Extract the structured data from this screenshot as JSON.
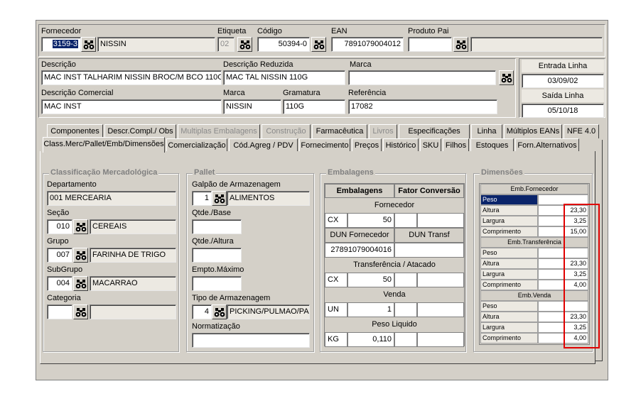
{
  "header": {
    "fornecedor_label": "Fornecedor",
    "fornecedor_code": "3159-3",
    "fornecedor_name": "NISSIN",
    "etiqueta_label": "Etiqueta",
    "etiqueta_value": "02",
    "codigo_label": "Código",
    "codigo_value": "50394-0",
    "ean_label": "EAN",
    "ean_value": "7891079004012",
    "produto_pai_label": "Produto Pai",
    "produto_pai_value": "",
    "descricao_label": "Descrição",
    "descricao_value": "MAC INST TALHARIM NISSIN BROC/M BCO 110G",
    "descricao_reduzida_label": "Descrição Reduzida",
    "descricao_reduzida_value": "MAC TAL NISSIN 110G",
    "marca_label": "Marca",
    "marca_top_value": "",
    "descricao_comercial_label": "Descrição Comercial",
    "descricao_comercial_value": "MAC INST",
    "marca2_label": "Marca",
    "marca2_value": "NISSIN",
    "gramatura_label": "Gramatura",
    "gramatura_value": "110G",
    "referencia_label": "Referência",
    "referencia_value": "17082",
    "entrada_linha_label": "Entrada Linha",
    "entrada_linha_value": "03/09/02",
    "saida_linha_label": "Saída Linha",
    "saida_linha_value": "05/10/18"
  },
  "tabs_row1": [
    {
      "label": "Componentes",
      "enabled": true
    },
    {
      "label": "Descr.Compl./ Obs",
      "enabled": true
    },
    {
      "label": "Multiplas Embalagens",
      "enabled": false
    },
    {
      "label": "Construção",
      "enabled": false
    },
    {
      "label": "Farmacêutica",
      "enabled": true
    },
    {
      "label": "Livros",
      "enabled": false
    },
    {
      "label": "Especificações",
      "enabled": true
    },
    {
      "label": "Linha",
      "enabled": true
    },
    {
      "label": "Múltiplos EANs",
      "enabled": true
    },
    {
      "label": "NFE 4.0",
      "enabled": true
    }
  ],
  "tabs_row2": [
    {
      "label": "Class.Merc/Pallet/Emb/Dimensões",
      "active": true
    },
    {
      "label": "Comercialização"
    },
    {
      "label": "Cód.Agreg / PDV"
    },
    {
      "label": "Fornecimento"
    },
    {
      "label": "Preços"
    },
    {
      "label": "Histórico"
    },
    {
      "label": "SKU"
    },
    {
      "label": "Filhos"
    },
    {
      "label": "Estoques"
    },
    {
      "label": "Forn.Alternativos"
    }
  ],
  "classificacao": {
    "title": "Classificação Mercadológica",
    "departamento_label": "Departamento",
    "departamento_value": "001 MERCEARIA",
    "secao_label": "Seção",
    "secao_code": "010",
    "secao_name": "CEREAIS",
    "grupo_label": "Grupo",
    "grupo_code": "007",
    "grupo_name": "FARINHA DE TRIGO",
    "subgrupo_label": "SubGrupo",
    "subgrupo_code": "004",
    "subgrupo_name": "MACARRAO",
    "categoria_label": "Categoria",
    "categoria_code": "",
    "categoria_name": ""
  },
  "pallet": {
    "title": "Pallet",
    "galpao_label": "Galpão de Armazenagem",
    "galpao_code": "1",
    "galpao_name": "ALIMENTOS",
    "qtde_base_label": "Qtde./Base",
    "qtde_base_value": "",
    "qtde_altura_label": "Qtde./Altura",
    "qtde_altura_value": "",
    "empto_label": "Empto.Máximo",
    "empto_value": "",
    "tipo_label": "Tipo de Armazenagem",
    "tipo_code": "4",
    "tipo_name": "PICKING/PULMAO/PALL",
    "normatizacao_label": "Normatização",
    "normatizacao_value": ""
  },
  "embalagens": {
    "title": "Embalagens",
    "col1": "Embalagens",
    "col2": "Fator Conversão",
    "fornecedor_label": "Fornecedor",
    "fornecedor_unit": "CX",
    "fornecedor_qty": "50",
    "dun_fornecedor_label": "DUN Fornecedor",
    "dun_transf_label": "DUN Transf",
    "dun_fornecedor_value": "27891079004016",
    "dun_transf_value": "",
    "transf_label": "Transferência / Atacado",
    "transf_unit": "CX",
    "transf_qty": "50",
    "venda_label": "Venda",
    "venda_unit": "UN",
    "venda_qty": "1",
    "peso_label": "Peso Liquido",
    "peso_unit": "KG",
    "peso_value": "0,110"
  },
  "dimensoes": {
    "title": "Dimensões",
    "fornecedor_header": "Emb.Fornecedor",
    "transferencia_header": "Emb.Transferência",
    "venda_header": "Emb.Venda",
    "fornecedor_rows": [
      {
        "label": "Peso",
        "value": ""
      },
      {
        "label": "Altura",
        "value": "23,30"
      },
      {
        "label": "Largura",
        "value": "3,25"
      },
      {
        "label": "Comprimento",
        "value": "15,00"
      }
    ],
    "transferencia_rows": [
      {
        "label": "Peso",
        "value": ""
      },
      {
        "label": "Altura",
        "value": "23,30"
      },
      {
        "label": "Largura",
        "value": "3,25"
      },
      {
        "label": "Comprimento",
        "value": "4,00"
      }
    ],
    "venda_rows": [
      {
        "label": "Peso",
        "value": ""
      },
      {
        "label": "Altura",
        "value": "23,30"
      },
      {
        "label": "Largura",
        "value": "3,25"
      },
      {
        "label": "Comprimento",
        "value": "4,00"
      }
    ],
    "highlight_color": "#e00000"
  },
  "icons": {
    "lookup": "binoculars-icon"
  }
}
